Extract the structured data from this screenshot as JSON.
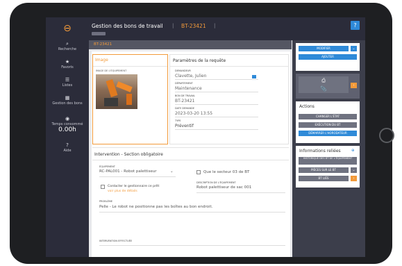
{
  "app": {
    "logo_glyph": "⊖",
    "nav": [
      {
        "icon": "search-icon",
        "glyph": "⌕",
        "label": "Recherche"
      },
      {
        "icon": "star-icon",
        "glyph": "★",
        "label": "Favoris"
      },
      {
        "icon": "list-icon",
        "glyph": "☰",
        "label": "Listes"
      },
      {
        "icon": "grid-icon",
        "glyph": "▦",
        "label": "Gestion des bons"
      },
      {
        "icon": "clock-icon",
        "glyph": "◉",
        "label": "Temps consommé",
        "value": "0.00h"
      },
      {
        "icon": "help-circle-icon",
        "glyph": "?",
        "label": "Aide"
      }
    ]
  },
  "header": {
    "title": "Gestion des bons de travail",
    "bt_number": "BT-23421",
    "help_label": "?"
  },
  "subbar": {
    "label": "BT-23421"
  },
  "image_section": {
    "title": "Image",
    "caption": "IMAGE DE L'ÉQUIPEMENT"
  },
  "params": {
    "title": "Paramètres de la requête",
    "fields": [
      {
        "label": "DEMANDEUR",
        "value": "Clavette, Julien"
      },
      {
        "label": "DÉPARTEMENT",
        "value": "Maintenance"
      },
      {
        "label": "BON DE TRAVAIL",
        "value": "BT-23421"
      },
      {
        "label": "DATE DEMANDE",
        "value": "2023-03-20 13:55"
      },
      {
        "label": "TYPE",
        "value": "Préventif"
      }
    ]
  },
  "intervention": {
    "title": "Intervention - Section obligatoire",
    "equipment_label": "ÉQUIPEMENT",
    "equipment_value": "RC-PAL001 - Robot palettiseur",
    "stop_label": "Que le secteur 03 de BT",
    "contact_label": "Contacter le gestionnaire ce prêt",
    "contact_link": "voir plus de détails",
    "desc_equip_label": "DESCRIPTION DE L'ÉQUIPEMENT",
    "desc_equip_value": "Robot palettiseur de sac 001",
    "problem_label": "PROBLÈME",
    "problem_value": "Pelle - Le robot ne positionne pas les boîtes au bon endroit.",
    "work_label": "INTERVENTION EFFECTUÉE"
  },
  "right_panel": {
    "btn_modifier": "MODIFIER",
    "btn_ajouter": "AJOUTER",
    "print_glyph": "⎙",
    "attach_glyph": "📎",
    "actions_title": "Actions",
    "actions": [
      "CHANGER L'ÉTAT",
      "EXÉCUTION DU BT",
      "DÉMARRER L'HORODATEUR"
    ],
    "related_title": "Informations reliées",
    "related": [
      "HISTORIQUE DES BT DE L'ÉQUIPEMENT",
      "PIÈCES SUR LE BT",
      "BT LIÉS"
    ],
    "colors": {
      "accent": "#2f8ad8",
      "orange": "#f29a3a",
      "dark": "#2b2c3a"
    }
  }
}
